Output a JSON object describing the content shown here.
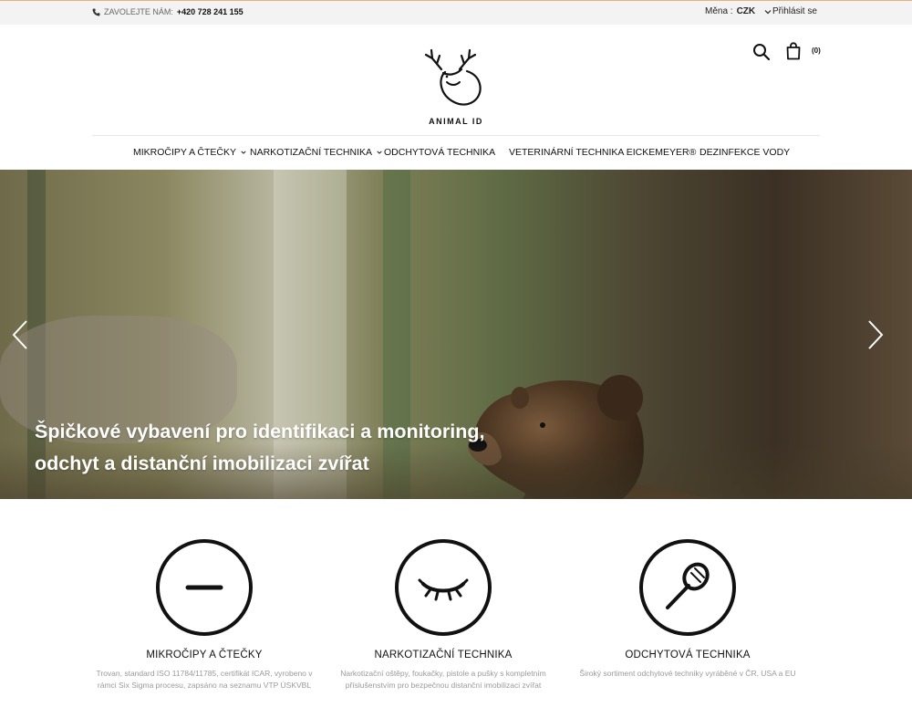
{
  "topbar": {
    "call_label": "ZAVOLEJTE NÁM:",
    "phone": "+420 728 241 155",
    "currency_label": "Měna :",
    "currency_value": "CZK",
    "login": "Přihlásit se"
  },
  "header": {
    "logo_text": "ANIMAL ID",
    "cart_count": "(0)"
  },
  "nav": {
    "items": [
      {
        "label": "MIKROČIPY A ČTEČKY",
        "dropdown": true
      },
      {
        "label": "NARKOTIZAČNÍ TECHNIKA",
        "dropdown": true
      },
      {
        "label": "ODCHYTOVÁ TECHNIKA",
        "dropdown": false
      },
      {
        "label": "VETERINÁRNÍ TECHNIKA EICKEMEYER®",
        "dropdown": false
      },
      {
        "label": "DEZINFEKCE VODY",
        "dropdown": false
      }
    ]
  },
  "hero": {
    "line1": "Špičkové vybavení pro identifikaci a monitoring,",
    "line2": "odchyt a distanční imobilizaci zvířat"
  },
  "features": [
    {
      "icon": "microchip-icon",
      "title": "MIKROČIPY A ČTEČKY",
      "desc": "Trovan, standard ISO 11784/11785, certifikát ICAR, vyrobeno v rámci Six Sigma procesu, zapsáno na seznamu VTP ÚSKVBL"
    },
    {
      "icon": "closed-eye-icon",
      "title": "NARKOTIZAČNÍ TECHNIKA",
      "desc": "Narkotizační oštěpy, foukačky, pistole a pušky s kompletním příslušenstvím pro bezpečnou distanční imobilizaci zvířat"
    },
    {
      "icon": "catch-net-icon",
      "title": "ODCHYTOVÁ TECHNIKA",
      "desc": "Široký sortiment odchytové techniky vyráběné v ČR, USA a EU"
    }
  ]
}
